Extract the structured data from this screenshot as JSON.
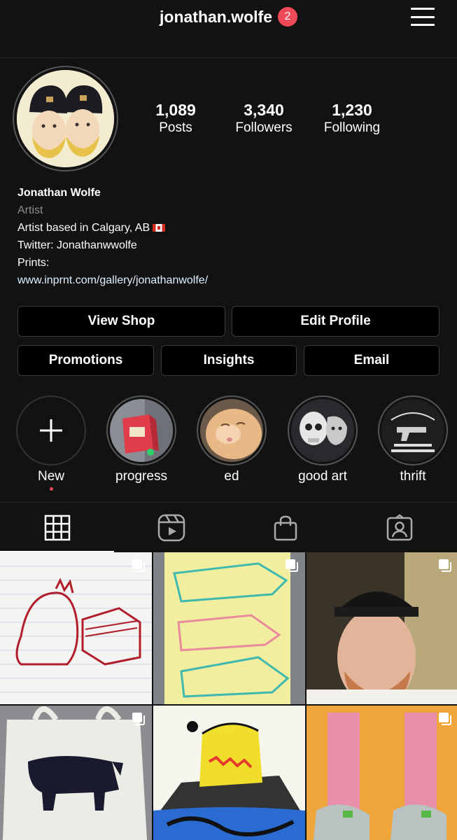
{
  "header": {
    "username": "jonathan.wolfe",
    "notifications": "2"
  },
  "profile": {
    "stats": [
      {
        "value": "1,089",
        "label": "Posts"
      },
      {
        "value": "3,340",
        "label": "Followers"
      },
      {
        "value": "1,230",
        "label": "Following"
      }
    ],
    "name": "Jonathan Wolfe",
    "category": "Artist",
    "bio_lines": [
      "Artist based in Calgary, AB",
      "Twitter: Jonathanwwolfe",
      "Prints:"
    ],
    "website": "www.inprnt.com/gallery/jonathanwolfe/"
  },
  "buttons": {
    "view_shop": "View Shop",
    "edit_profile": "Edit Profile",
    "promotions": "Promotions",
    "insights": "Insights",
    "email": "Email"
  },
  "highlights": [
    {
      "label": "New"
    },
    {
      "label": "progress"
    },
    {
      "label": "ed"
    },
    {
      "label": "good art"
    },
    {
      "label": "thrift"
    }
  ],
  "tabs": [
    {
      "icon": "grid-icon",
      "active": true
    },
    {
      "icon": "reels-icon",
      "active": false
    },
    {
      "icon": "shop-bag-icon",
      "active": false
    },
    {
      "icon": "tagged-icon",
      "active": false
    }
  ],
  "colors": {
    "background": "#121212",
    "badge": "#ed4956",
    "link": "#e0f1ff",
    "muted": "#8e8e8e"
  }
}
